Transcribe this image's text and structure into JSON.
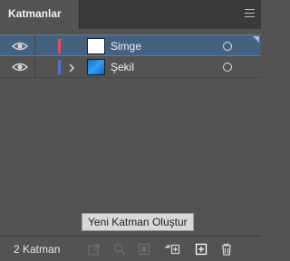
{
  "panel": {
    "tab_title": "Katmanlar",
    "menu_icon": "hamburger-menu-icon"
  },
  "layers": [
    {
      "name": "Simge",
      "color": "#e05050",
      "visible": true,
      "selected": true,
      "expandable": false,
      "thumbnail": "white"
    },
    {
      "name": "Şekil",
      "color": "#4f6ee8",
      "visible": true,
      "selected": false,
      "expandable": true,
      "thumbnail": "blue-gradient"
    }
  ],
  "tooltip": {
    "text": "Yeni Katman Oluştur"
  },
  "footer": {
    "layer_count": "2 Katman",
    "buttons": [
      {
        "icon": "export-icon",
        "enabled": false
      },
      {
        "icon": "locate-object-icon",
        "enabled": false
      },
      {
        "icon": "make-clipping-mask-icon",
        "enabled": false
      },
      {
        "icon": "create-sublayer-icon",
        "enabled": true
      },
      {
        "icon": "create-new-layer-icon",
        "enabled": true
      },
      {
        "icon": "delete-icon",
        "enabled": true
      }
    ]
  },
  "colors": {
    "panel_bg": "#535353",
    "selection_bg": "#46617f",
    "header_bg": "#3a3a3a"
  }
}
